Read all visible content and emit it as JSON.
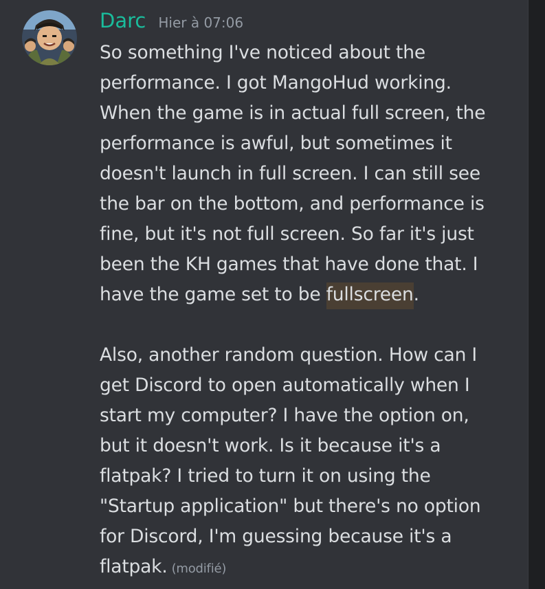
{
  "message": {
    "author": "Darc",
    "timestamp": "Hier à 07:06",
    "avatar_icon": "avatar-image",
    "username_color": "#1abc9c",
    "lines": [
      "So something I've noticed about the",
      "performance. I got MangoHud working.",
      "When the game is in actual full screen, the",
      "performance is awful, but sometimes it",
      "doesn't launch in full screen. I can still see",
      "the bar on the bottom, and performance is",
      "fine, but it's not full screen. So far it's just",
      "been the KH games that have done that. I"
    ],
    "line9_prefix": "have the game set to be ",
    "line9_highlight": "fullscreen",
    "line9_suffix": ".",
    "paragraph2": [
      "Also, another random question. How can I",
      "get Discord to open automatically when I",
      "start my computer? I have the option on,",
      "but it doesn't work. Is it because it's a",
      "flatpak? I tried to turn it on using the",
      "\"Startup application\" but there's no option",
      "for Discord, I'm guessing because it's a"
    ],
    "last_line": "flatpak.",
    "edited_label": "(modifié)",
    "highlight_color": "#4a3f33"
  }
}
